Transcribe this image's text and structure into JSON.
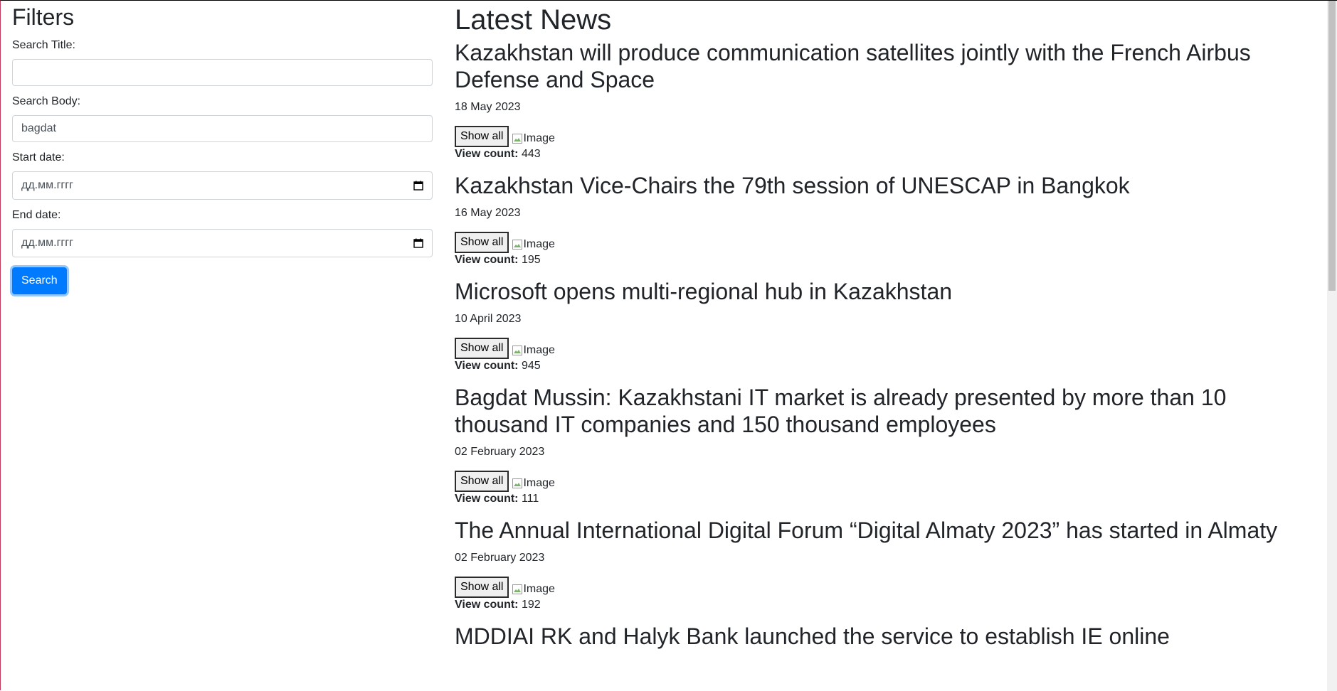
{
  "filters": {
    "title": "Filters",
    "search_title_label": "Search Title:",
    "search_title_value": "",
    "search_body_label": "Search Body:",
    "search_body_value": "bagdat",
    "start_date_label": "Start date:",
    "start_date_placeholder": "дд.мм.гггг",
    "end_date_label": "End date:",
    "end_date_placeholder": "дд.мм.гггг",
    "search_button": "Search"
  },
  "news": {
    "title": "Latest News",
    "show_all_label": "Show all",
    "image_alt": "Image",
    "view_count_label": "View count:",
    "items": [
      {
        "title": "Kazakhstan will produce communication satellites jointly with the French Airbus Defense and Space",
        "date": "18 May 2023",
        "views": "443"
      },
      {
        "title": "Kazakhstan Vice-Chairs the 79th session of UNESCAP in Bangkok",
        "date": "16 May 2023",
        "views": "195"
      },
      {
        "title": "Microsoft opens multi-regional hub in Kazakhstan",
        "date": "10 April 2023",
        "views": "945"
      },
      {
        "title": "Bagdat Mussin: Kazakhstani IT market is already presented by more than 10 thousand IT companies and 150 thousand employees",
        "date": "02 February 2023",
        "views": "111"
      },
      {
        "title": "The Annual International Digital Forum “Digital Almaty 2023” has started in Almaty",
        "date": "02 February 2023",
        "views": "192"
      },
      {
        "title": "MDDIAI RK and Halyk Bank launched the service to establish IE online",
        "date": "",
        "views": ""
      }
    ]
  }
}
